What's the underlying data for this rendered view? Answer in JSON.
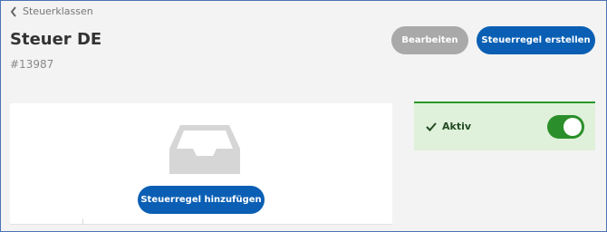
{
  "breadcrumb": {
    "label": "Steuerklassen"
  },
  "header": {
    "title": "Steuer DE",
    "id": "#13987",
    "edit_label": "Bearbeiten",
    "create_label": "Steuerregel erstellen"
  },
  "rules_card": {
    "empty_icon": "inbox-icon",
    "add_label": "Steuerregel hinzufügen"
  },
  "status": {
    "label": "Aktiv",
    "active": true,
    "icon": "check-icon"
  },
  "colors": {
    "primary": "#0a5fb4",
    "disabled": "#a9a9a9",
    "success_bg": "#dff1da",
    "success": "#2a8f2a"
  }
}
